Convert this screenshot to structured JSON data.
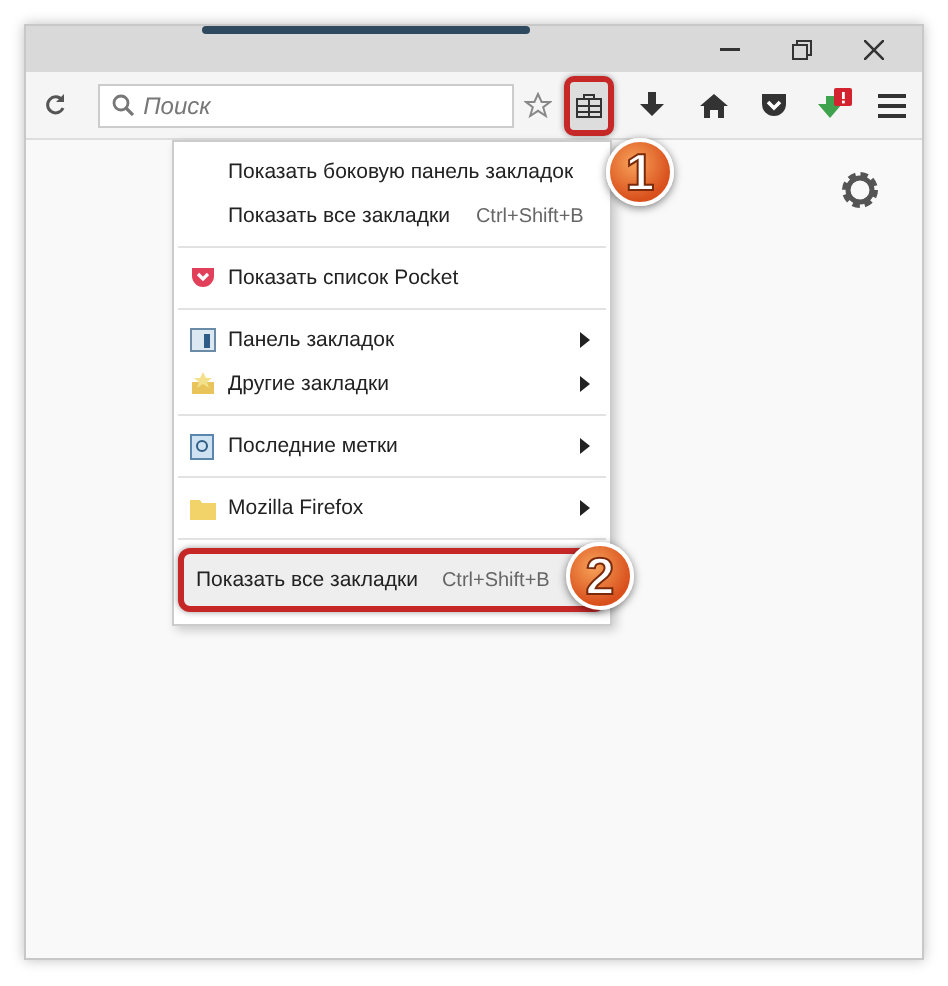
{
  "search": {
    "placeholder": "Поиск"
  },
  "menu": [
    {
      "kind": "item",
      "selected": false,
      "label": "Показать боковую панель закладок"
    },
    {
      "kind": "item",
      "selected": false,
      "label": "Показать все закладки",
      "shortcut": "Ctrl+Shift+B"
    },
    {
      "kind": "separator"
    },
    {
      "kind": "item",
      "selected": false,
      "label": "Показать список Pocket"
    },
    {
      "kind": "separator"
    },
    {
      "kind": "submenu",
      "selected": false,
      "label": "Панель закладок"
    },
    {
      "kind": "submenu",
      "selected": false,
      "label": "Другие закладки"
    },
    {
      "kind": "separator"
    },
    {
      "kind": "submenu",
      "selected": false,
      "label": "Последние метки"
    },
    {
      "kind": "separator"
    },
    {
      "kind": "submenu",
      "selected": false,
      "label": "Mozilla Firefox"
    },
    {
      "kind": "separator"
    },
    {
      "kind": "item",
      "selected": true,
      "label": "Показать все закладки",
      "shortcut": "Ctrl+Shift+B"
    }
  ],
  "callouts": [
    "1",
    "2"
  ]
}
